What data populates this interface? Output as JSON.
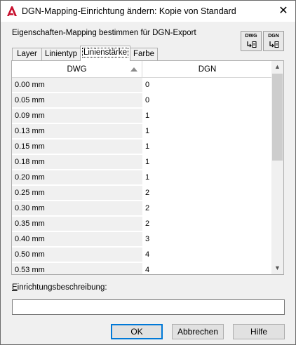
{
  "window": {
    "title": "DGN-Mapping-Einrichtung ändern: Kopie von Standard",
    "close_glyph": "✕",
    "app_icon": "autocad-a-icon"
  },
  "header": {
    "subtitle": "Eigenschaften-Mapping bestimmen für DGN-Export",
    "toolbar": [
      {
        "label": "DWG",
        "icon": "map-dwg-icon"
      },
      {
        "label": "DGN",
        "icon": "map-dgn-icon"
      }
    ]
  },
  "tabs": [
    {
      "label": "Layer",
      "active": false
    },
    {
      "label": "Linientyp",
      "active": false
    },
    {
      "label": "Linienstärke",
      "active": true
    },
    {
      "label": "Farbe",
      "active": false
    }
  ],
  "grid": {
    "columns": [
      "DWG",
      "DGN"
    ],
    "sort_icon": "sort-ascending-icon",
    "rows": [
      {
        "dwg": "0.00 mm",
        "dgn": "0"
      },
      {
        "dwg": "0.05 mm",
        "dgn": "0"
      },
      {
        "dwg": "0.09 mm",
        "dgn": "1"
      },
      {
        "dwg": "0.13 mm",
        "dgn": "1"
      },
      {
        "dwg": "0.15 mm",
        "dgn": "1"
      },
      {
        "dwg": "0.18 mm",
        "dgn": "1"
      },
      {
        "dwg": "0.20 mm",
        "dgn": "1"
      },
      {
        "dwg": "0.25 mm",
        "dgn": "2"
      },
      {
        "dwg": "0.30 mm",
        "dgn": "2"
      },
      {
        "dwg": "0.35 mm",
        "dgn": "2"
      },
      {
        "dwg": "0.40 mm",
        "dgn": "3"
      },
      {
        "dwg": "0.50 mm",
        "dgn": "4"
      },
      {
        "dwg": "0.53 mm",
        "dgn": "4"
      }
    ],
    "scroll_up_glyph": "▲",
    "scroll_down_glyph": "▼"
  },
  "description": {
    "label_underlined": "E",
    "label_rest": "inrichtungsbeschreibung:",
    "value": ""
  },
  "buttons": {
    "ok": "OK",
    "cancel": "Abbrechen",
    "help": "Hilfe"
  },
  "colors": {
    "accent": "#0078d7",
    "app_icon_red": "#c8102e"
  }
}
